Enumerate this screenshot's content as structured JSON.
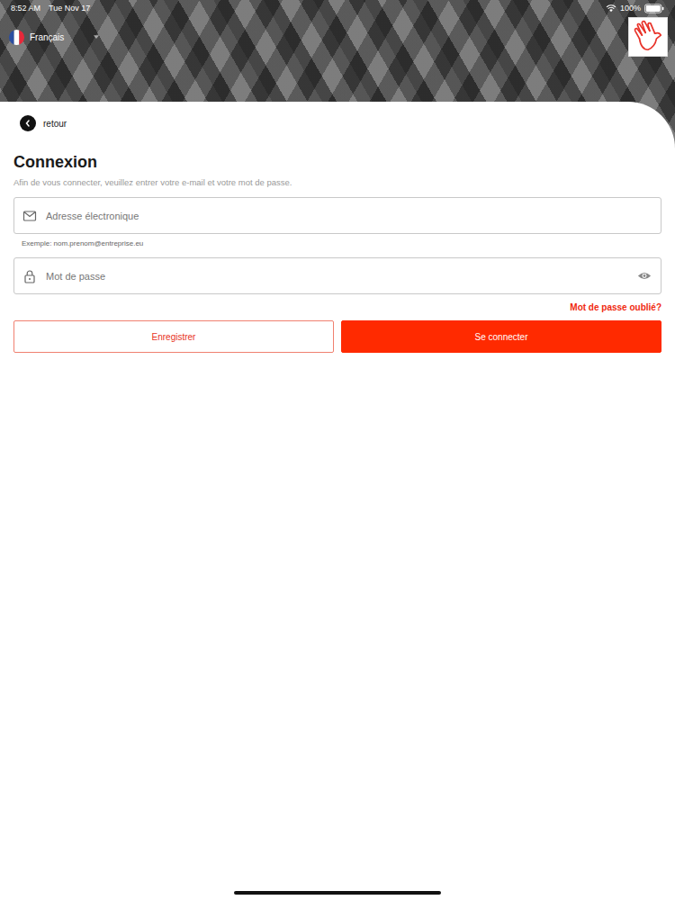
{
  "status_bar": {
    "time": "8:52 AM",
    "date": "Tue Nov 17",
    "battery": "100%"
  },
  "language": {
    "label": "Français"
  },
  "back": {
    "label": "retour"
  },
  "title": "Connexion",
  "subtitle": "Afin de vous connecter, veuillez entrer votre e-mail et votre mot de passe.",
  "fields": [
    {
      "kind": "email",
      "placeholder": "Adresse électronique",
      "hint": "Exemple: nom.prenom@entreprise.eu"
    },
    {
      "kind": "password",
      "placeholder": "Mot de passe"
    }
  ],
  "forgot": "Mot de passe oublié?",
  "buttons": [
    {
      "label": "Enregistrer",
      "kind": "secondary"
    },
    {
      "label": "Se connecter",
      "kind": "primary"
    }
  ]
}
